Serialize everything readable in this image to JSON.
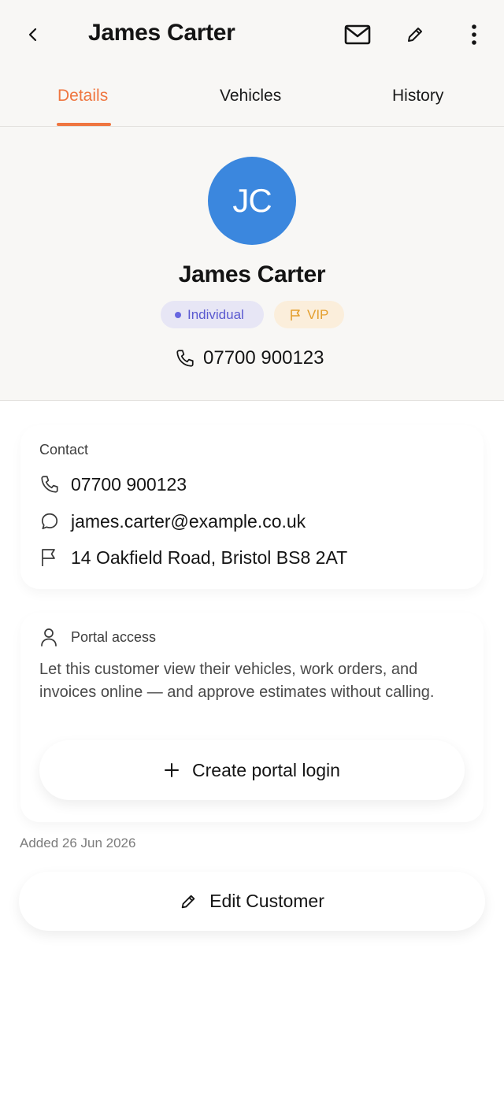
{
  "header": {
    "title": "James Carter",
    "icons": {
      "back": "chevron-left-icon",
      "mail": "mail-icon",
      "edit": "pencil-icon",
      "more": "more-vertical-icon"
    }
  },
  "tabs": [
    {
      "label": "Details",
      "active": true
    },
    {
      "label": "Vehicles",
      "active": false
    },
    {
      "label": "History",
      "active": false
    }
  ],
  "profile": {
    "initials": "JC",
    "name": "James Carter",
    "badges": {
      "type": "Individual",
      "vip": "VIP"
    },
    "phone": "07700 900123"
  },
  "contact": {
    "label": "Contact",
    "phone": "07700 900123",
    "email": "james.carter@example.co.uk",
    "address": "14 Oakfield Road, Bristol BS8 2AT"
  },
  "portal": {
    "label": "Portal access",
    "description": "Let this customer view their vehicles, work orders, and invoices online — and approve estimates without calling.",
    "button_label": "Create portal login"
  },
  "meta": {
    "added": "Added 26 Jun 2026"
  },
  "actions": {
    "edit_label": "Edit Customer"
  },
  "colors": {
    "accent": "#ef7640",
    "avatar": "#3b87de",
    "individual_badge_bg": "#e7e6f5",
    "individual_badge_text": "#5a59d0",
    "vip_badge_bg": "#fbeedb",
    "vip_badge_text": "#e49f2e"
  }
}
